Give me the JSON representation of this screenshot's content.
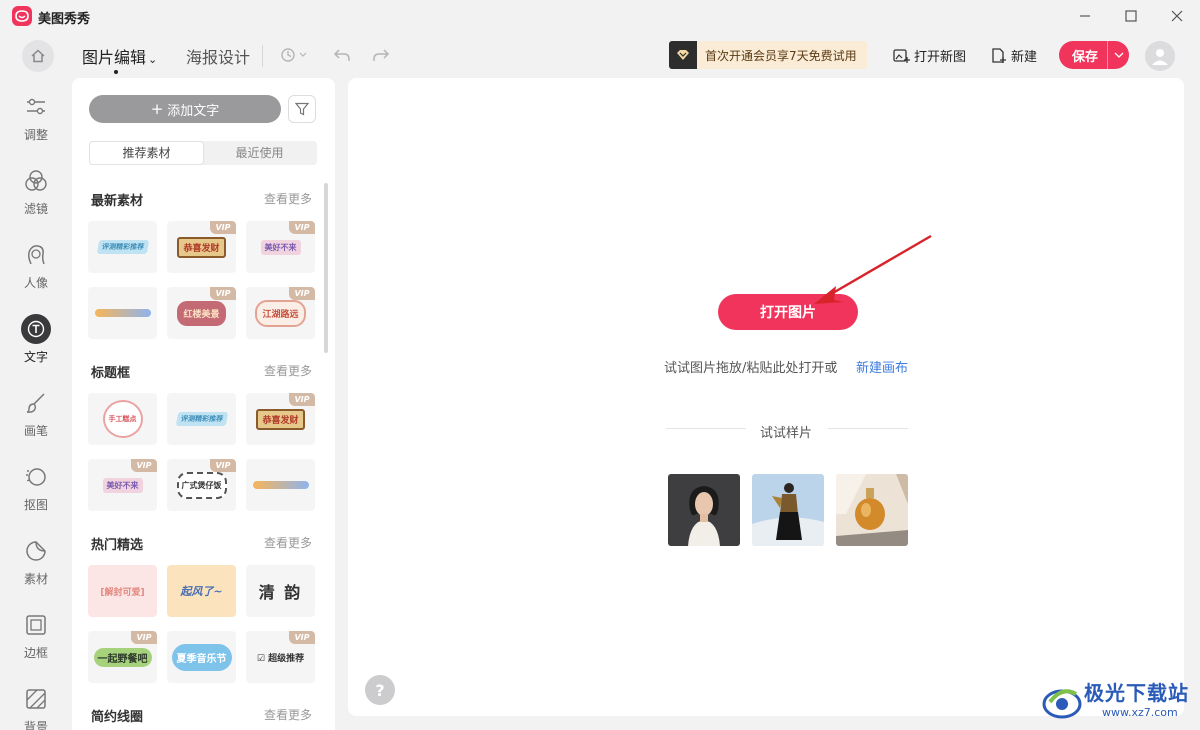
{
  "app": {
    "title": "美图秀秀"
  },
  "toolbar": {
    "tab_edit": "图片编辑",
    "tab_poster": "海报设计",
    "vip_banner": "首次开通会员享7天免费试用",
    "open_new": "打开新图",
    "new": "新建",
    "save": "保存"
  },
  "rail": {
    "items": [
      {
        "label": "调整",
        "icon": "sliders-icon"
      },
      {
        "label": "滤镜",
        "icon": "filter-circles-icon"
      },
      {
        "label": "人像",
        "icon": "portrait-icon"
      },
      {
        "label": "文字",
        "icon": "text-icon",
        "active": true
      },
      {
        "label": "画笔",
        "icon": "brush-icon"
      },
      {
        "label": "抠图",
        "icon": "cutout-icon"
      },
      {
        "label": "素材",
        "icon": "sticker-icon"
      },
      {
        "label": "边框",
        "icon": "frame-icon"
      },
      {
        "label": "背景",
        "icon": "background-icon"
      }
    ]
  },
  "panel": {
    "add_text": "添加文字",
    "tab_recommended": "推荐素材",
    "tab_recent": "最近使用",
    "see_more": "查看更多",
    "vip_tag": "VIP",
    "sections": [
      {
        "title": "最新素材",
        "items": [
          {
            "text": "评测精彩推荐",
            "vip": false
          },
          {
            "text": "恭喜发财",
            "vip": true
          },
          {
            "text": "美好不来",
            "vip": true
          },
          {
            "text": "",
            "vip": false
          },
          {
            "text": "红楼美景",
            "vip": true
          },
          {
            "text": "江湖路远",
            "vip": true
          }
        ]
      },
      {
        "title": "标题框",
        "items": [
          {
            "text": "手工糕点",
            "vip": false
          },
          {
            "text": "评测精彩推荐",
            "vip": false
          },
          {
            "text": "恭喜发财",
            "vip": true
          },
          {
            "text": "美好不来",
            "vip": true
          },
          {
            "text": "广式煲仔饭",
            "vip": true
          },
          {
            "text": "",
            "vip": false
          }
        ]
      },
      {
        "title": "热门精选",
        "items": [
          {
            "text": "[解封可爱]",
            "vip": false
          },
          {
            "text": "起风了~",
            "vip": false
          },
          {
            "text": "清 韵",
            "vip": false
          },
          {
            "text": "一起野餐吧",
            "vip": true
          },
          {
            "text": "夏季音乐节",
            "vip": false
          },
          {
            "text": "超级推荐",
            "vip": true
          }
        ]
      },
      {
        "title": "简约线圈",
        "items": []
      }
    ]
  },
  "canvas": {
    "open_image": "打开图片",
    "hint": "试试图片拖放/粘贴此处打开或",
    "new_canvas": "新建画布",
    "samples_label": "试试样片",
    "samples": [
      {
        "name": "portrait-woman-sample"
      },
      {
        "name": "fashion-woman-sample"
      },
      {
        "name": "perfume-sample"
      }
    ],
    "help": "?"
  },
  "watermark": {
    "text": "极光下载站",
    "url": "www.xz7.com"
  },
  "colors": {
    "accent": "#f0345c",
    "link": "#3c7ce0",
    "vip_bg": "#faecd6"
  }
}
